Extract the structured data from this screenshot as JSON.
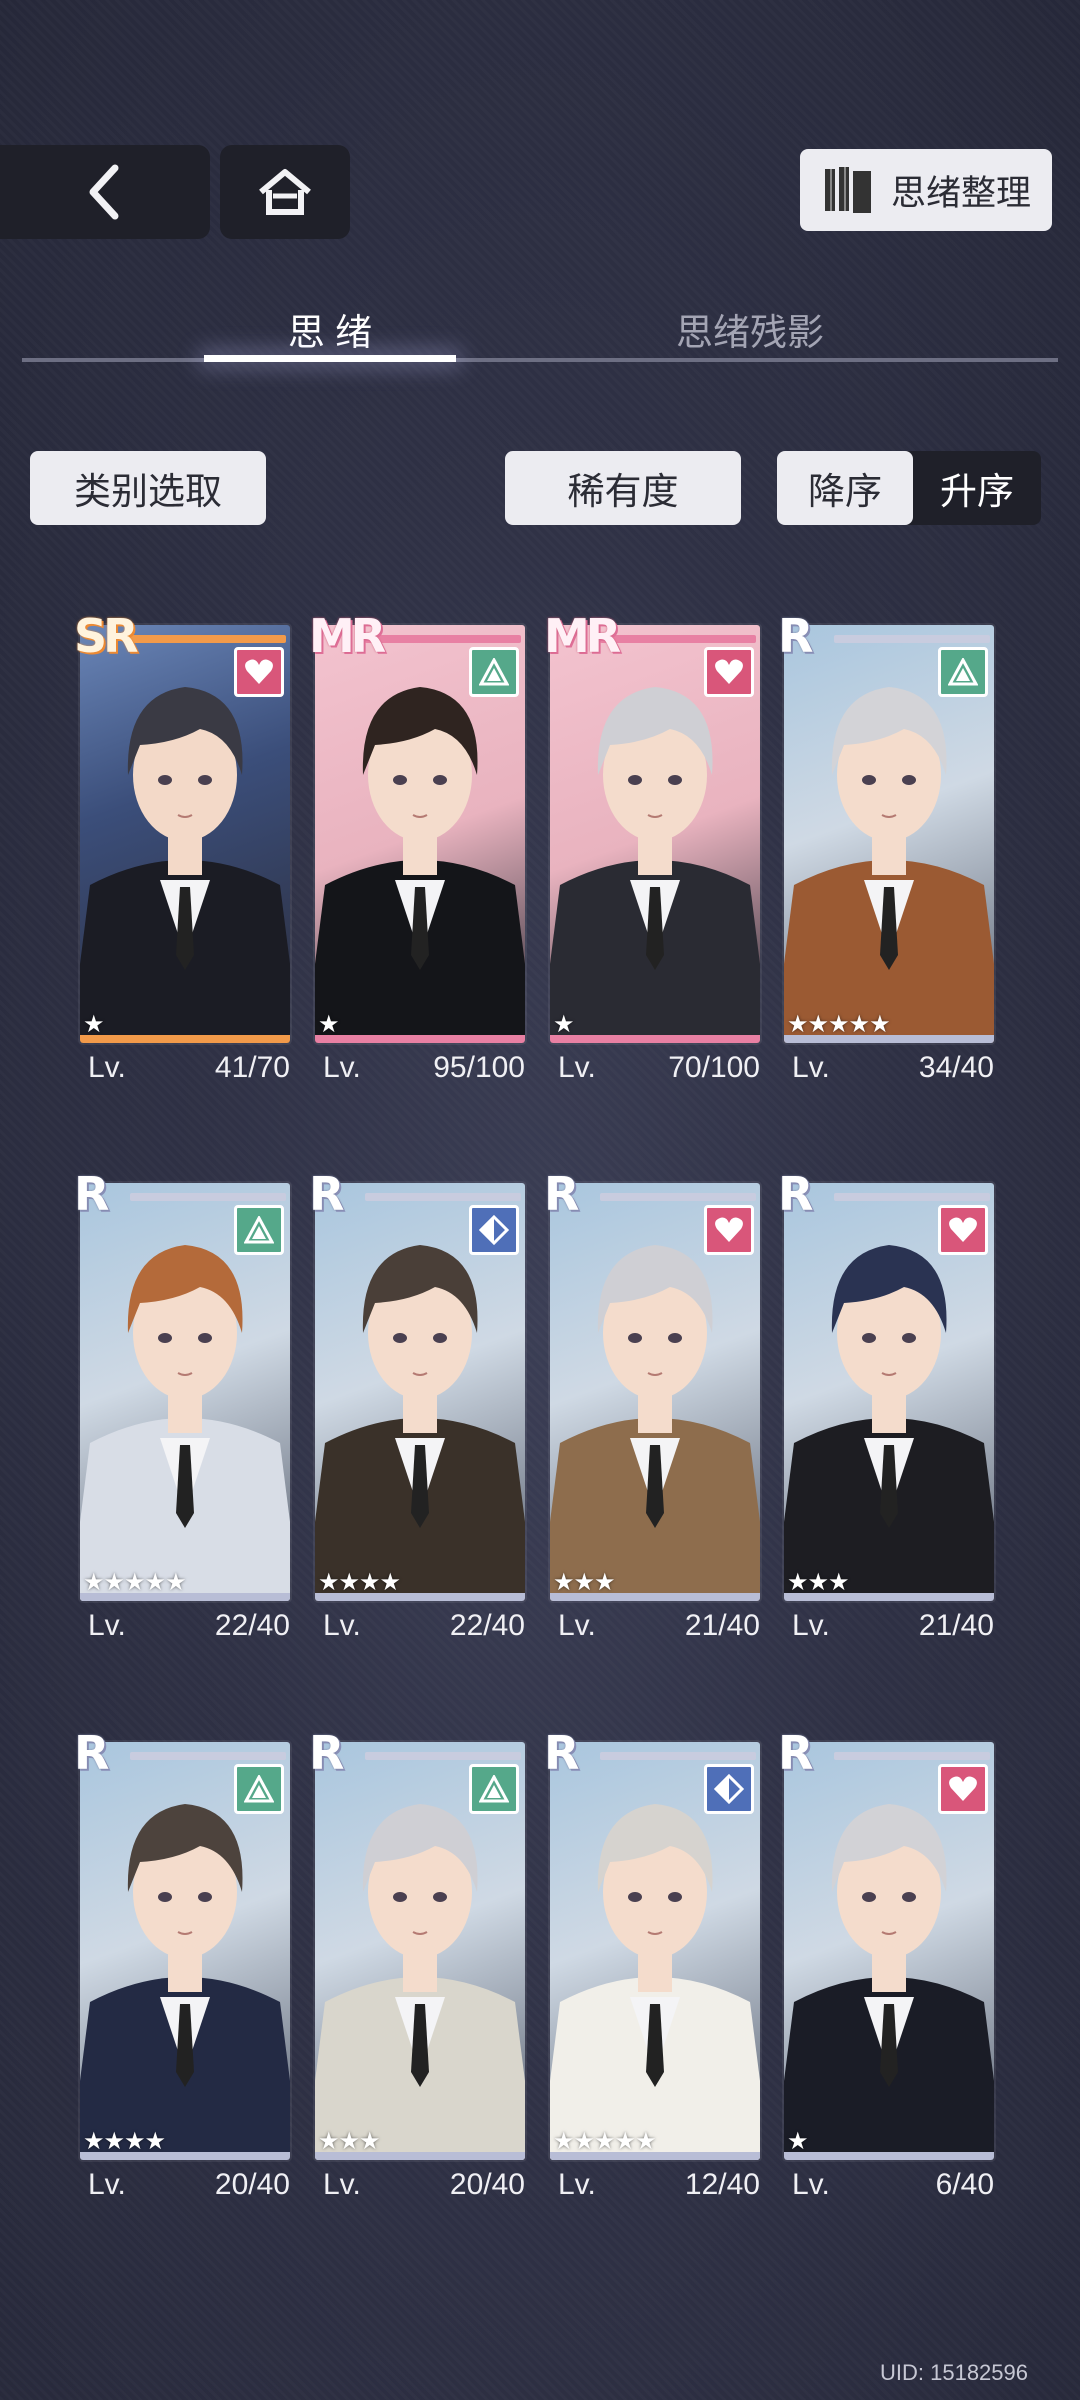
{
  "nav": {
    "back_icon": "chevron-left-icon",
    "home_icon": "home-icon"
  },
  "organize": {
    "label": "思绪整理",
    "icon": "cards-icon"
  },
  "tabs": [
    {
      "label": "思 绪",
      "active": true
    },
    {
      "label": "思绪残影",
      "active": false
    }
  ],
  "filters": {
    "category": "类别选取",
    "rarity": "稀有度",
    "desc": "降序",
    "asc": "升序",
    "sort_active": "desc"
  },
  "cards": [
    {
      "rarity": "SR",
      "attr": "heart",
      "stars": "★",
      "lv_label": "Lv.",
      "lv": "41/70",
      "theme": "sr"
    },
    {
      "rarity": "MR",
      "attr": "triangle",
      "stars": "★",
      "lv_label": "Lv.",
      "lv": "95/100",
      "theme": "mr"
    },
    {
      "rarity": "MR",
      "attr": "heart",
      "stars": "★",
      "lv_label": "Lv.",
      "lv": "70/100",
      "theme": "mr"
    },
    {
      "rarity": "R",
      "attr": "triangle",
      "stars": "★★★★★",
      "lv_label": "Lv.",
      "lv": "34/40",
      "theme": "r"
    },
    {
      "rarity": "R",
      "attr": "triangle",
      "stars": "★★★★★",
      "lv_label": "Lv.",
      "lv": "22/40",
      "theme": "r"
    },
    {
      "rarity": "R",
      "attr": "diamond",
      "stars": "★★★★",
      "lv_label": "Lv.",
      "lv": "22/40",
      "theme": "r"
    },
    {
      "rarity": "R",
      "attr": "heart",
      "stars": "★★★",
      "lv_label": "Lv.",
      "lv": "21/40",
      "theme": "r"
    },
    {
      "rarity": "R",
      "attr": "heart",
      "stars": "★★★",
      "lv_label": "Lv.",
      "lv": "21/40",
      "theme": "r"
    },
    {
      "rarity": "R",
      "attr": "triangle",
      "stars": "★★★★",
      "lv_label": "Lv.",
      "lv": "20/40",
      "theme": "r"
    },
    {
      "rarity": "R",
      "attr": "triangle",
      "stars": "★★★",
      "lv_label": "Lv.",
      "lv": "20/40",
      "theme": "r"
    },
    {
      "rarity": "R",
      "attr": "diamond",
      "stars": "★★★★★",
      "lv_label": "Lv.",
      "lv": "12/40",
      "theme": "r"
    },
    {
      "rarity": "R",
      "attr": "heart",
      "stars": "★",
      "lv_label": "Lv.",
      "lv": "6/40",
      "theme": "r"
    }
  ],
  "colors": {
    "heart": "#d9567a",
    "triangle": "#55a88a",
    "diamond": "#4f6fb8"
  },
  "uid": "UID: 15182596"
}
